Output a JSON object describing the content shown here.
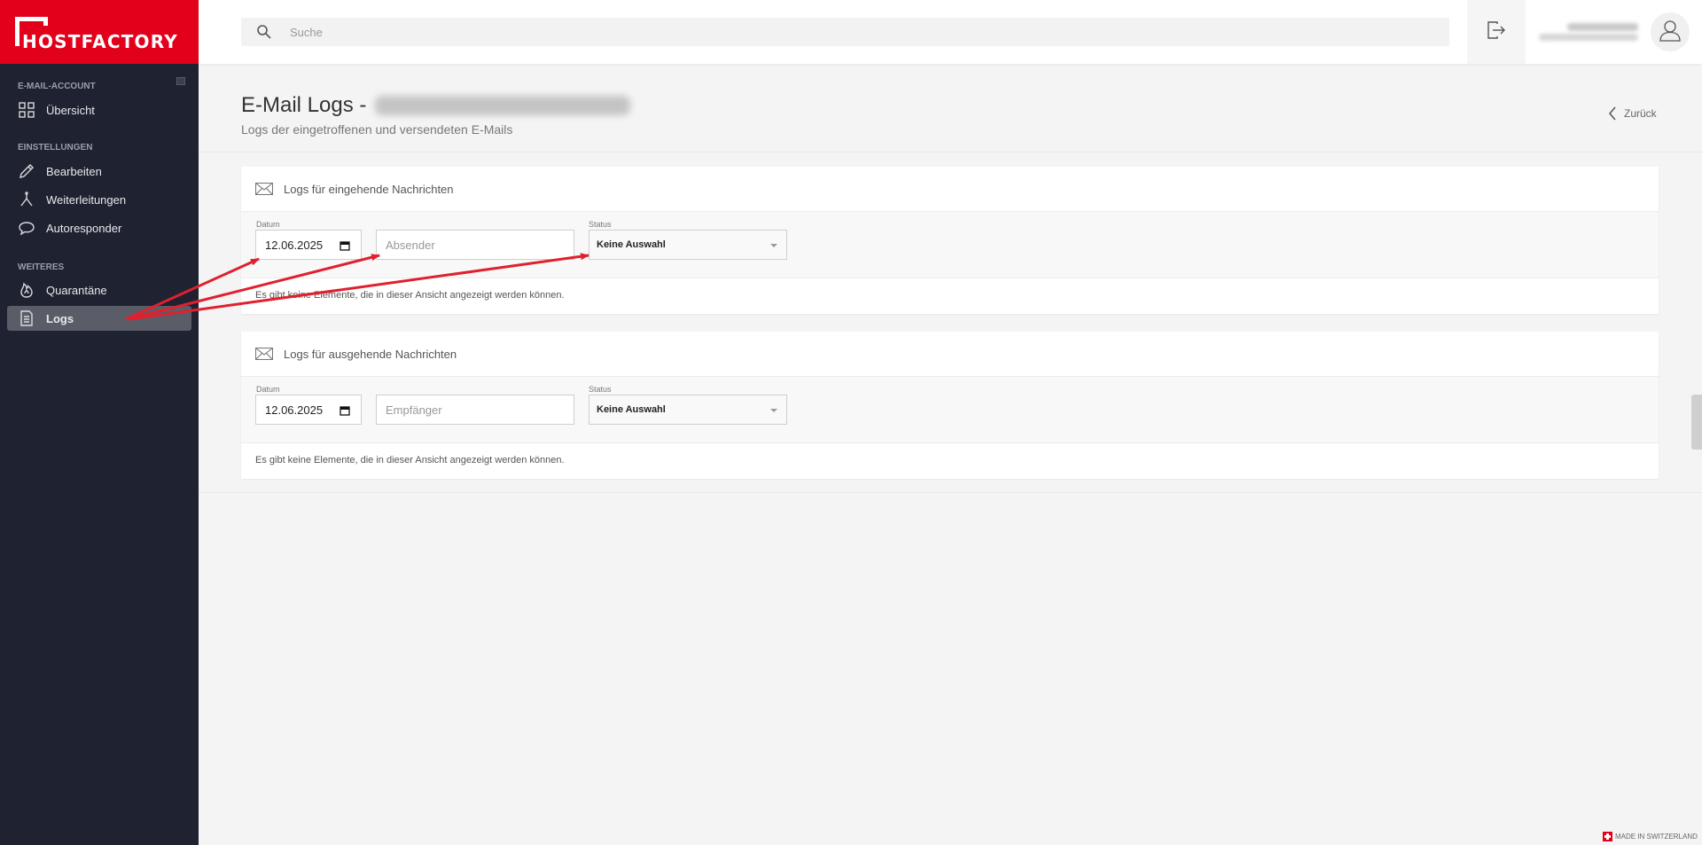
{
  "brand": {
    "name": "HOSTFACTORY"
  },
  "sidebar": {
    "sections": [
      {
        "title": "E-MAIL-ACCOUNT",
        "items": [
          {
            "label": "Übersicht",
            "icon": "grid-icon"
          }
        ]
      },
      {
        "title": "EINSTELLUNGEN",
        "items": [
          {
            "label": "Bearbeiten",
            "icon": "pencil-icon"
          },
          {
            "label": "Weiterleitungen",
            "icon": "fork-icon"
          },
          {
            "label": "Autoresponder",
            "icon": "speech-bubble-icon"
          }
        ]
      },
      {
        "title": "WEITERES",
        "items": [
          {
            "label": "Quarantäne",
            "icon": "flame-icon"
          },
          {
            "label": "Logs",
            "icon": "document-icon",
            "active": true
          }
        ]
      }
    ]
  },
  "topbar": {
    "search_placeholder": "Suche",
    "logout_icon": "logout-icon",
    "avatar_icon": "user-icon"
  },
  "page": {
    "title": "E-Mail Logs -",
    "subtitle": "Logs der eingetroffenen und versendeten E-Mails",
    "back_label": "Zurück"
  },
  "incoming": {
    "title": "Logs für eingehende Nachrichten",
    "date_label": "Datum",
    "date_value": "12.06.2025",
    "sender_placeholder": "Absender",
    "status_label": "Status",
    "status_value": "Keine Auswahl",
    "empty_text": "Es gibt keine Elemente, die in dieser Ansicht angezeigt werden können."
  },
  "outgoing": {
    "title": "Logs für ausgehende Nachrichten",
    "date_label": "Datum",
    "date_value": "12.06.2025",
    "recipient_placeholder": "Empfänger",
    "status_label": "Status",
    "status_value": "Keine Auswahl",
    "empty_text": "Es gibt keine Elemente, die in dieser Ansicht angezeigt werden können."
  },
  "footer": {
    "made_in": "MADE IN SWITZERLAND"
  },
  "colors": {
    "brand_red": "#e2001a",
    "sidebar_bg": "#1f2230",
    "annotation_arrow": "#e0202e"
  }
}
